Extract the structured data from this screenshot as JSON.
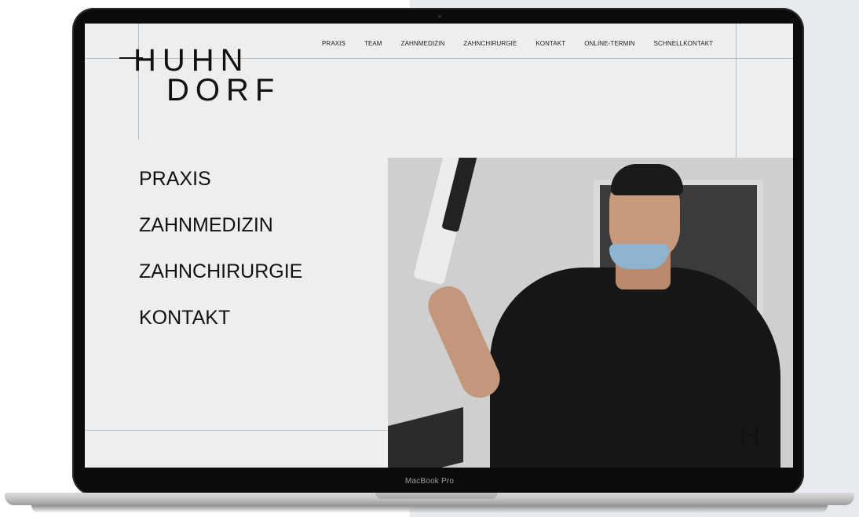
{
  "device": {
    "label": "MacBook Pro"
  },
  "site": {
    "logo": {
      "line1": "HUHN",
      "line2": "DORF"
    },
    "topnav": [
      "PRAXIS",
      "TEAM",
      "ZAHNMEDIZIN",
      "ZAHNCHIRURGIE",
      "KONTAKT",
      "ONLINE-TERMIN",
      "SCHNELLKONTAKT"
    ],
    "mainnav": [
      "PRAXIS",
      "ZAHNMEDIZIN",
      "ZAHNCHIRURGIE",
      "KONTAKT"
    ],
    "corner_mark": "H"
  },
  "colors": {
    "page_bg": "#eceeef",
    "text": "#111111",
    "lines": "#b9bcbf",
    "scrubs": "#151617"
  }
}
